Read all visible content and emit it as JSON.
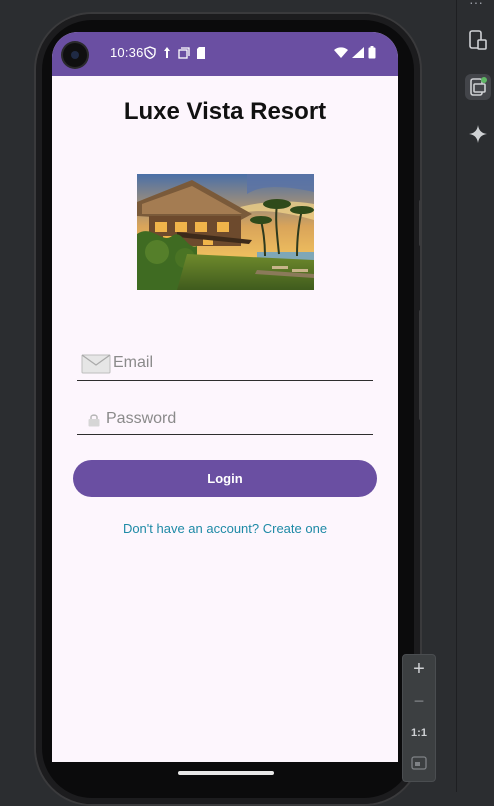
{
  "status_bar": {
    "time": "10:36",
    "left_icons": [
      "shield-icon",
      "location-icon",
      "copy-icon",
      "sd-card-icon"
    ],
    "right_icons": [
      "wifi-icon",
      "signal-icon",
      "battery-icon"
    ],
    "color": "#6a4fa2"
  },
  "app": {
    "title": "Luxe Vista Resort",
    "hero_image": "resort-bungalow-image",
    "email_placeholder": "Email",
    "password_placeholder": "Password",
    "login_label": "Login",
    "signup_link": "Don't have an account? Create one",
    "accent": "#6a4fa2",
    "link_color": "#1e8aa6",
    "background": "#fdf6fd"
  },
  "emulator_controls": {
    "zoom_in": "+",
    "zoom_out": "−",
    "actual_size": "1:1"
  },
  "ide": {
    "icons": [
      "device-manager-icon",
      "running-devices-icon",
      "gemini-icon"
    ]
  }
}
